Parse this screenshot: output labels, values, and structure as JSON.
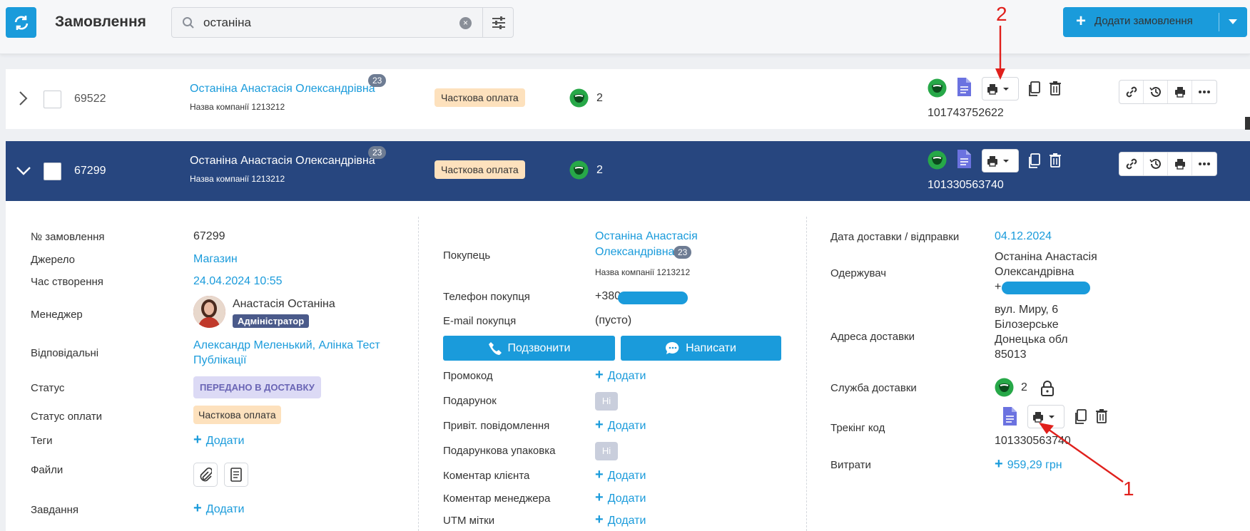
{
  "header": {
    "title": "Замовлення",
    "search_value": "останіна",
    "add_order_label": "Додати замовлення"
  },
  "orders": [
    {
      "id": "69522",
      "customer": "Останіна Анастасія Олександрівна",
      "company": "Назва компанії 1213212",
      "order_count": "23",
      "payment_status": "Часткова оплата",
      "delivery_count": "2",
      "tracking": "101743752622",
      "expanded": false
    },
    {
      "id": "67299",
      "customer": "Останіна Анастасія Олександрівна",
      "company": "Назва компанії 1213212",
      "order_count": "23",
      "payment_status": "Часткова оплата",
      "delivery_count": "2",
      "tracking": "101330563740",
      "expanded": true
    }
  ],
  "detail": {
    "col1": {
      "order_no_label": "№ замовлення",
      "order_no": "67299",
      "source_label": "Джерело",
      "source": "Магазин",
      "created_label": "Час створення",
      "created": "24.04.2024 10:55",
      "manager_label": "Менеджер",
      "manager_name": "Анастасія Останіна",
      "manager_role": "Адміністратор",
      "responsible_label": "Відповідальні",
      "responsible_line1": "Александр Меленький, Алінка Тест",
      "responsible_line2": "Публікації",
      "status_label": "Статус",
      "status": "ПЕРЕДАНО В ДОСТАВКУ",
      "pay_status_label": "Статус оплати",
      "pay_status": "Часткова оплата",
      "tags_label": "Теги",
      "add_label": "Додати",
      "files_label": "Файли",
      "tasks_label": "Завдання"
    },
    "col2": {
      "buyer_label": "Покупець",
      "buyer_line1": "Останіна Анастасія",
      "buyer_line2": "Олександрівна",
      "buyer_count": "23",
      "buyer_company": "Назва компанії 1213212",
      "phone_label": "Телефон покупця",
      "phone_prefix": "+380",
      "email_label": "E-mail покупця",
      "email": "(пусто)",
      "call_label": "Подзвонити",
      "write_label": "Написати",
      "promo_label": "Промокод",
      "gift_label": "Подарунок",
      "greeting_label": "Привіт. повідомлення",
      "gift_wrap_label": "Подарункова упаковка",
      "client_comment_label": "Коментар клієнта",
      "manager_comment_label": "Коментар менеджера",
      "utm_label": "UTM мітки",
      "no_label": "Ні",
      "add_label": "Додати"
    },
    "col3": {
      "delivery_date_label": "Дата доставки / відправки",
      "delivery_date": "04.12.2024",
      "recipient_label": "Одержувач",
      "recipient_line1": "Останіна Анастасія",
      "recipient_line2": "Олександрівна",
      "recipient_phone_prefix": "+",
      "address_label": "Адреса доставки",
      "address_line1": "вул. Миру, 6",
      "address_line2": "Білозерське",
      "address_line3": "Донецька обл",
      "address_line4": "85013",
      "service_label": "Служба доставки",
      "service_count": "2",
      "tracking_label": "Трекінг код",
      "tracking": "101330563740",
      "expenses_label": "Витрати",
      "expenses": "959,29 грн"
    }
  },
  "annotations": {
    "label_1": "1",
    "label_2": "2"
  },
  "colors": {
    "accent": "#1a9bdb",
    "expanded_row": "#27467f",
    "payment_badge": "#fde1bd",
    "status_badge": "#dcdaf5",
    "annotation": "#e0201c"
  }
}
